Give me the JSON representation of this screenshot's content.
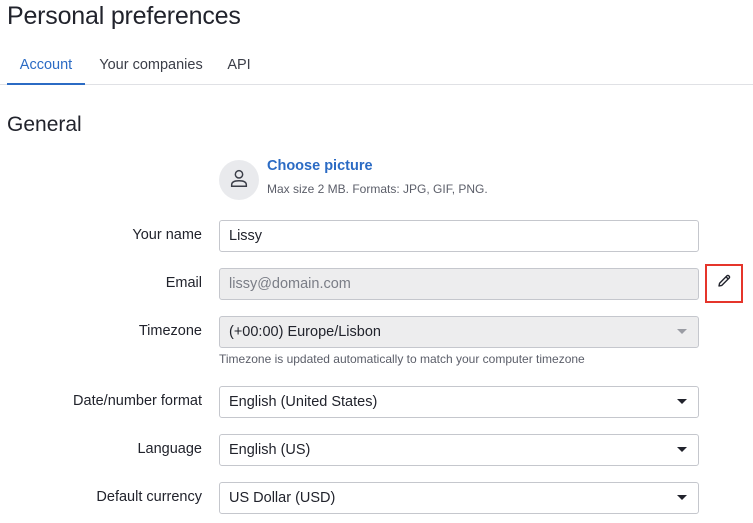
{
  "header": {
    "title": "Personal preferences"
  },
  "tabs": [
    {
      "label": "Account",
      "active": true
    },
    {
      "label": "Your companies",
      "active": false
    },
    {
      "label": "API",
      "active": false
    }
  ],
  "section": {
    "title": "General"
  },
  "picture": {
    "link_label": "Choose picture",
    "hint": "Max size 2 MB. Formats: JPG, GIF, PNG.",
    "icon": "user-icon"
  },
  "form": {
    "name": {
      "label": "Your name",
      "value": "Lissy"
    },
    "email": {
      "label": "Email",
      "value": "lissy@domain.com",
      "disabled": true,
      "edit_icon": "pencil-icon"
    },
    "timezone": {
      "label": "Timezone",
      "value": "(+00:00) Europe/Lisbon",
      "disabled": true,
      "help": "Timezone is updated automatically to match your computer timezone"
    },
    "date_format": {
      "label": "Date/number format",
      "value": "English (United States)"
    },
    "language": {
      "label": "Language",
      "value": "English (US)"
    },
    "currency": {
      "label": "Default currency",
      "value": "US Dollar (USD)"
    }
  },
  "colors": {
    "accent": "#2b6bc4",
    "highlight": "#e5352b",
    "disabled_bg": "#ededee"
  }
}
